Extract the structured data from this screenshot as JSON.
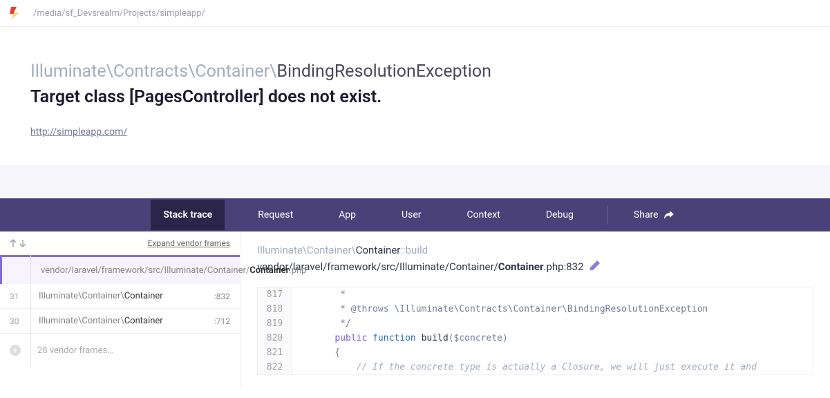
{
  "topbar": {
    "path": "/media/sf_Devsrealm/Projects/simpleapp/"
  },
  "header": {
    "exception_namespace": "Illuminate\\Contracts\\Container\\",
    "exception_class": "BindingResolutionException",
    "message": "Target class [PagesController] does not exist.",
    "url": "http://simpleapp.com/"
  },
  "tabs": {
    "stack_trace": "Stack trace",
    "request": "Request",
    "app": "App",
    "user": "User",
    "context": "Context",
    "debug": "Debug",
    "share": "Share"
  },
  "frames": {
    "expand_label": "Expand vendor frames",
    "selected": {
      "path_prefix": "vendor/laravel/framework/src/Illuminate/Container/",
      "file": "Container",
      "ext": ".php"
    },
    "items": [
      {
        "num": "31",
        "ns": "Illuminate\\Container\\",
        "cls": "Container",
        "line": ":832"
      },
      {
        "num": "30",
        "ns": "Illuminate\\Container\\",
        "cls": "Container",
        "line": ":712"
      }
    ],
    "vendor_collapsed": "28 vendor frames…"
  },
  "code": {
    "header_ns": "Illuminate\\Container\\",
    "header_cls": "Container",
    "header_method": "::build",
    "path_prefix": "vendor/laravel/framework/src/Illuminate/Container/",
    "path_file": "Container",
    "path_ext": ".php:",
    "path_line": "832",
    "lines": {
      "l817": {
        "n": "817",
        "t": "     *"
      },
      "l818": {
        "n": "818",
        "t": "     * @throws \\Illuminate\\Contracts\\Container\\BindingResolutionException"
      },
      "l819": {
        "n": "819",
        "t": "     */"
      },
      "l820": {
        "n": "820"
      },
      "l821": {
        "n": "821",
        "t": "    {"
      },
      "l822": {
        "n": "822",
        "t": "        // If the concrete type is actually a Closure, we will just execute it and"
      }
    },
    "tokens": {
      "public": "public",
      "function": "function",
      "build": "build",
      "params": "($concrete)"
    }
  }
}
